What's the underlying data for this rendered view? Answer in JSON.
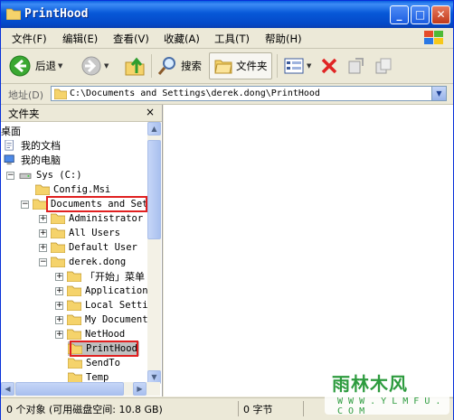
{
  "window": {
    "title": "PrintHood"
  },
  "menu": [
    "文件(F)",
    "编辑(E)",
    "查看(V)",
    "收藏(A)",
    "工具(T)",
    "帮助(H)"
  ],
  "toolbar": {
    "back": "后退",
    "search": "搜索",
    "folders": "文件夹"
  },
  "address": {
    "label": "地址(D)",
    "path": "C:\\Documents and Settings\\derek.dong\\PrintHood"
  },
  "folders_pane": {
    "title": "文件夹",
    "close": "×",
    "tree": [
      "桌面",
      "我的文档",
      "我的电脑",
      "Sys (C:)",
      "Config.Msi",
      "Documents and Set",
      "Administrator",
      "All Users",
      "Default User",
      "derek.dong",
      "「开始」菜单",
      "Application",
      "Local Setti",
      "My Document",
      "NetHood",
      "PrintHood",
      "SendTo",
      "Temp"
    ]
  },
  "status": {
    "objects": "0 个对象 (可用磁盘空间: 10.8 GB)",
    "size": "0 字节"
  },
  "watermark": {
    "title": "雨林木风",
    "url": "W W W . Y L M F U . C O M"
  },
  "colors": {
    "titlebar": "#0758d8",
    "highlight_box": "#e02020",
    "watermark": "#2d9b3e"
  }
}
